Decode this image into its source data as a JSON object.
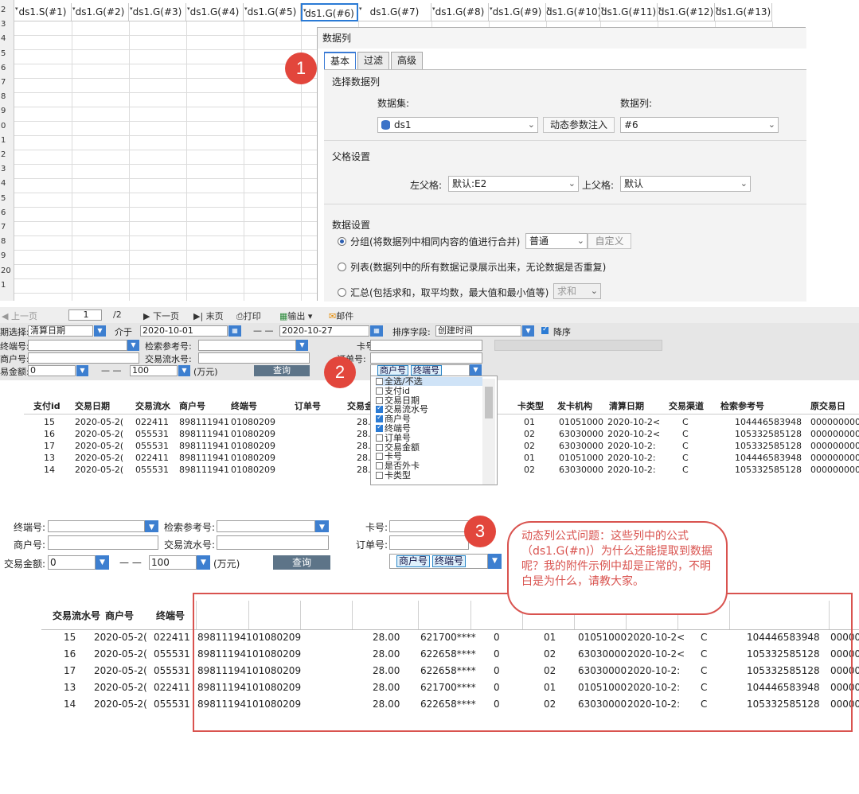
{
  "sheet": {
    "row_numbers": [
      "2",
      "3",
      "4",
      "5",
      "6",
      "7",
      "8",
      "9",
      "0",
      "1",
      "2",
      "3",
      "4",
      "5",
      "6",
      "7",
      "8",
      "9",
      "20",
      "1"
    ],
    "columns": [
      "ds1.S(#1)",
      "ds1.G(#2)",
      "ds1.G(#3)",
      "ds1.G(#4)",
      "ds1.G(#5)",
      "ds1.G(#6)",
      "ds1.G(#7)",
      "ds1.G(#8)",
      "ds1.G(#9)",
      "ds1.G(#10)",
      "ds1.G(#11)",
      "ds1.G(#12)",
      "ds1.G(#13)"
    ],
    "selected_column": "ds1.G(#6)"
  },
  "dialog": {
    "title": "数据列",
    "tabs": [
      "基本",
      "过滤",
      "高级"
    ],
    "active_tab": "基本",
    "section_select": "选择数据列",
    "dataset_label": "数据集:",
    "dataset_value": "ds1",
    "dynamic_param_button": "动态参数注入",
    "datacol_label": "数据列:",
    "datacol_value": "#6",
    "section_parent": "父格设置",
    "left_parent_label": "左父格:",
    "left_parent_value": "默认:E2",
    "top_parent_label": "上父格:",
    "top_parent_value": "默认",
    "section_data": "数据设置",
    "radio_group": "分组(将数据列中相同内容的值进行合并)",
    "group_mode": "普通",
    "custom_button": "自定义",
    "radio_list": "列表(数据列中的所有数据记录展示出来，无论数据是否重复)",
    "radio_sum": "汇总(包括求和，取平均数，最大值和最小值等)",
    "sum_mode": "求和"
  },
  "callouts": [
    "1",
    "2",
    "3"
  ],
  "report": {
    "toolbar": {
      "prev": "◀ 上一页",
      "page_current": "1",
      "page_total": "/2",
      "next": "▶ 下一页",
      "last": "▶| 末页",
      "print": "打印",
      "export": "输出",
      "mail": "邮件"
    },
    "params": {
      "period_label": "期选择:",
      "period_value": "清算日期",
      "between_label": "介于",
      "date_from": "2020-10-01",
      "dash": "— —",
      "date_to": "2020-10-27",
      "sort_label": "排序字段:",
      "sort_value": "创建时间",
      "desc_label": "降序",
      "terminal_label": "终端号:",
      "ref_label": "检索参考号:",
      "card_label": "卡号:",
      "merchant_label": "商户号:",
      "serial_label": "交易流水号:",
      "order_label": "订单号:",
      "amount_label": "易金额:",
      "amount_value": "0",
      "amount_dash": "— —",
      "amount_max": "100",
      "unit_label": "(万元)",
      "query_button": "查询",
      "selected_tags": [
        "商户号",
        "终端号"
      ]
    },
    "table": {
      "headers": [
        "支付id",
        "交易日期",
        "交易流水",
        "商户号",
        "终端号",
        "订单号",
        "交易金",
        "卡类型",
        "发卡机构",
        "清算日期",
        "交易渠道",
        "检索参考号",
        "原交易日"
      ],
      "rows": [
        [
          "15",
          "2020-05-2(",
          "022411",
          "898111941",
          "01080209",
          "",
          "28.",
          "01",
          "01051000",
          "2020-10-2<",
          "C",
          "104446583948",
          "000000000"
        ],
        [
          "16",
          "2020-05-2(",
          "055531",
          "898111941",
          "01080209",
          "",
          "28.",
          "02",
          "63030000",
          "2020-10-2<",
          "C",
          "105332585128",
          "000000000"
        ],
        [
          "17",
          "2020-05-2(",
          "055531",
          "898111941",
          "01080209",
          "",
          "28.",
          "02",
          "63030000",
          "2020-10-2:",
          "C",
          "105332585128",
          "000000000"
        ],
        [
          "13",
          "2020-05-2(",
          "022411",
          "898111941",
          "01080209",
          "",
          "28.",
          "01",
          "01051000",
          "2020-10-2:",
          "C",
          "104446583948",
          "000000000"
        ],
        [
          "14",
          "2020-05-2(",
          "055531",
          "898111941",
          "01080209",
          "",
          "28.",
          "02",
          "63030000",
          "2020-10-2:",
          "C",
          "105332585128",
          "000000000"
        ]
      ]
    },
    "dropdown_items": [
      {
        "label": "全选/不选",
        "checked": false
      },
      {
        "label": "支付id",
        "checked": false
      },
      {
        "label": "交易日期",
        "checked": false
      },
      {
        "label": "交易流水号",
        "checked": true
      },
      {
        "label": "商户号",
        "checked": true
      },
      {
        "label": "终端号",
        "checked": true
      },
      {
        "label": "订单号",
        "checked": false
      },
      {
        "label": "交易金额",
        "checked": false
      },
      {
        "label": "卡号",
        "checked": false
      },
      {
        "label": "是否外卡",
        "checked": false
      },
      {
        "label": "卡类型",
        "checked": false
      }
    ]
  },
  "section3": {
    "terminal_label": "终端号:",
    "ref_label": "检索参考号:",
    "card_label": "卡号:",
    "merchant_label": "商户号:",
    "serial_label": "交易流水号:",
    "order_label": "订单号:",
    "amount_label": "交易金额:",
    "amount_value": "0",
    "amount_dash": "— —",
    "amount_max": "100",
    "unit_label": "(万元)",
    "query_button": "查询",
    "selected_tags": [
      "商户号",
      "终端号"
    ],
    "headers": [
      "交易流水号",
      "商户号",
      "终端号"
    ],
    "rows": [
      [
        "15",
        "2020-05-2(",
        "022411",
        "898111941",
        "01080209",
        "28.00",
        "621700****",
        "0",
        "01",
        "01051000",
        "2020-10-2<",
        "C",
        "104446583948",
        "00000"
      ],
      [
        "16",
        "2020-05-2(",
        "055531",
        "898111941",
        "01080209",
        "28.00",
        "622658****",
        "0",
        "02",
        "63030000",
        "2020-10-2<",
        "C",
        "105332585128",
        "00000"
      ],
      [
        "17",
        "2020-05-2(",
        "055531",
        "898111941",
        "01080209",
        "28.00",
        "622658****",
        "0",
        "02",
        "63030000",
        "2020-10-2:",
        "C",
        "105332585128",
        "00000"
      ],
      [
        "13",
        "2020-05-2(",
        "022411",
        "898111941",
        "01080209",
        "28.00",
        "621700****",
        "0",
        "01",
        "01051000",
        "2020-10-2:",
        "C",
        "104446583948",
        "00000"
      ],
      [
        "14",
        "2020-05-2(",
        "055531",
        "898111941",
        "01080209",
        "28.00",
        "622658****",
        "0",
        "02",
        "63030000",
        "2020-10-2:",
        "C",
        "105332585128",
        "00000"
      ]
    ],
    "bubble_text": "动态列公式问题：这些列中的公式（ds1.G(#n)）为什么还能提取到数据呢？我的附件示例中却是正常的，不明白是为什么，请教大家。"
  },
  "colors": {
    "accent": "#2a7ad5",
    "callout": "#e2463c",
    "annotation": "#d9534f"
  }
}
